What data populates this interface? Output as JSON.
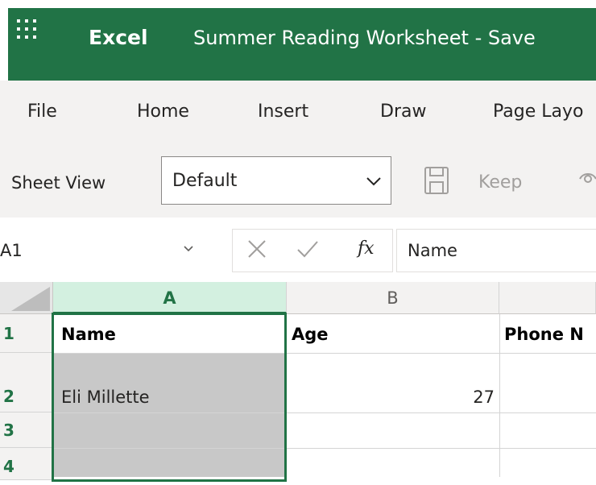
{
  "app": {
    "name": "Excel",
    "document_title": "Summer Reading Worksheet  -  Save"
  },
  "ribbon": {
    "tabs": [
      "File",
      "Home",
      "Insert",
      "Draw",
      "Page Layo"
    ]
  },
  "toolbar": {
    "sheet_view_label": "Sheet View",
    "view_select_value": "Default",
    "keep_label": "Keep"
  },
  "formula_bar": {
    "name_box_value": "A1",
    "fx_label": "fx",
    "formula_value": "Name"
  },
  "grid": {
    "columns": [
      "A",
      "B"
    ],
    "rows": [
      "1",
      "2",
      "3",
      "4"
    ],
    "header_row": {
      "a": "Name",
      "b": "Age",
      "c": "Phone N"
    },
    "row2": {
      "a": "Eli Millette",
      "b": "27"
    },
    "selected_column": "A",
    "selected_cell": "A1"
  },
  "colors": {
    "brand": "#217346",
    "selection_fill": "#c8c8c8",
    "column_header_selected": "#d3f0e0"
  },
  "icons": {
    "app_launcher": "waffle-icon",
    "save": "save-icon",
    "cancel": "close-icon",
    "confirm": "check-icon",
    "view": "eye-icon"
  }
}
